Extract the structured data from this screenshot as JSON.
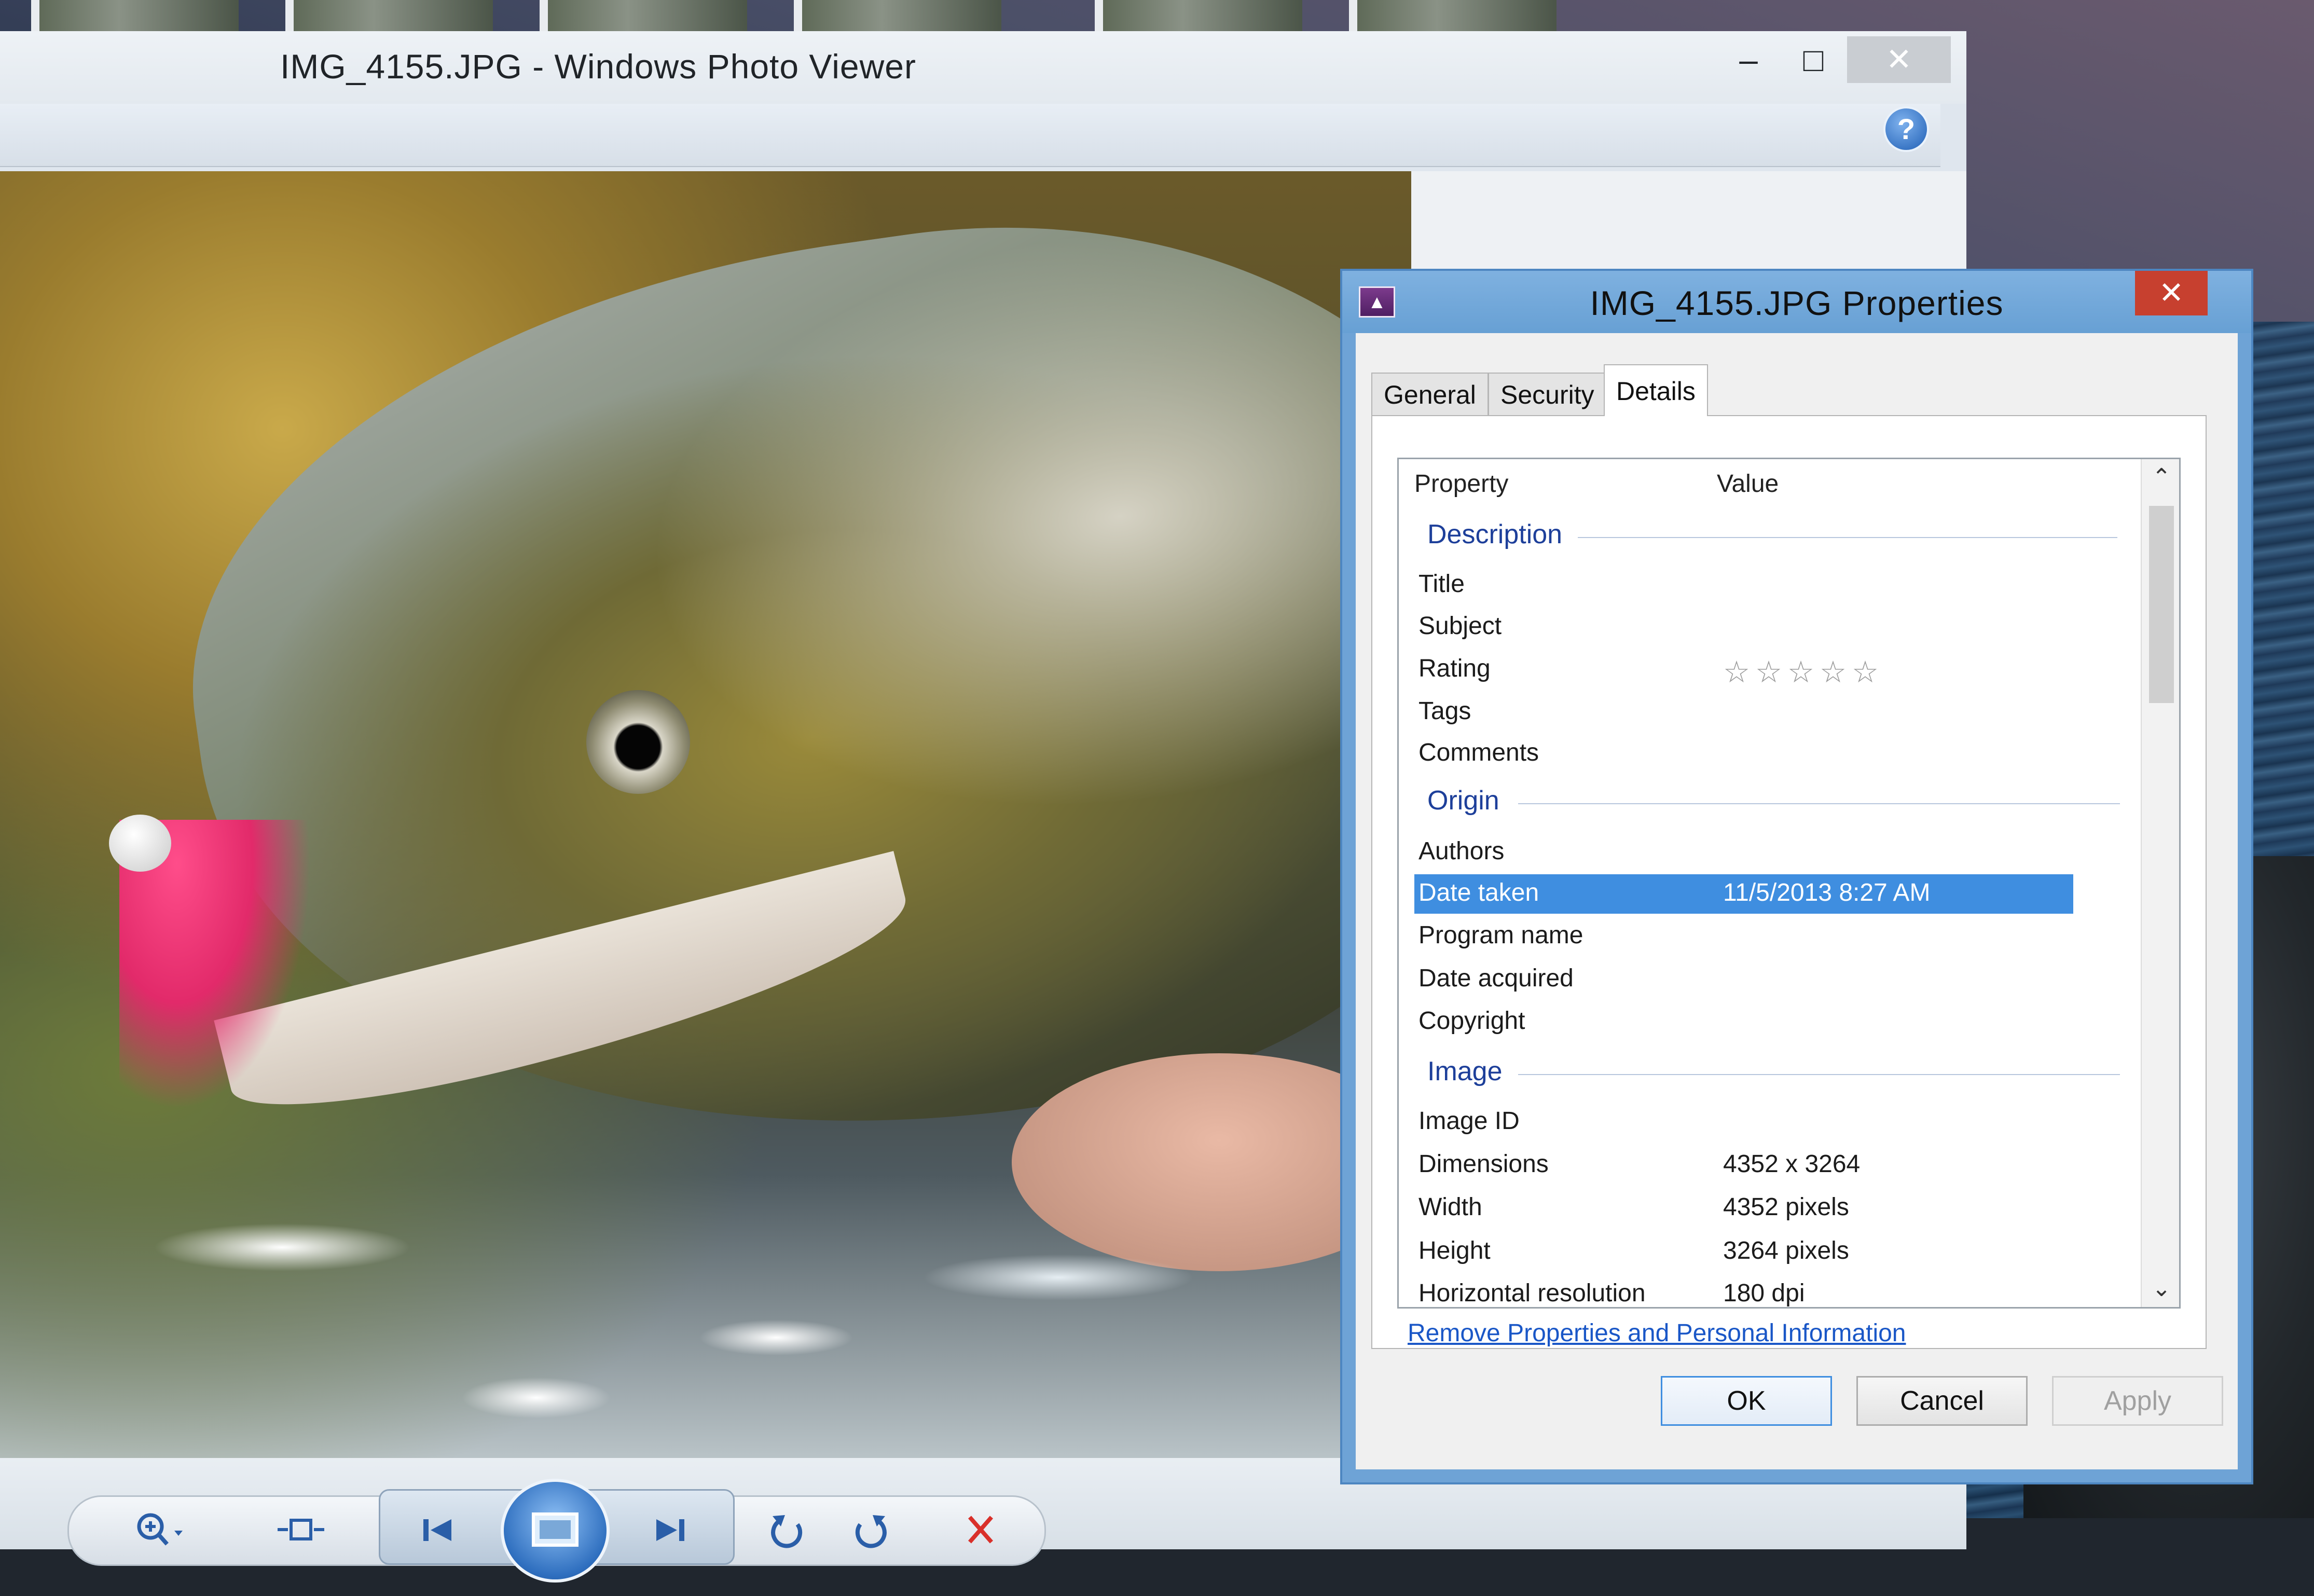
{
  "viewer": {
    "title": "IMG_4155.JPG - Windows Photo Viewer",
    "minimize_glyph": "–",
    "maximize_glyph": "□",
    "close_glyph": "✕",
    "help_glyph": "?",
    "help_icon": "help-icon"
  },
  "controls": {
    "zoom_icon": "zoom-icon",
    "fit_icon": "actual-size-icon",
    "prev_icon": "previous-icon",
    "slideshow_icon": "slideshow-icon",
    "next_icon": "next-icon",
    "rotate_ccw_icon": "rotate-counterclockwise-icon",
    "rotate_cw_icon": "rotate-clockwise-icon",
    "delete_icon": "delete-icon",
    "colors": {
      "accent": "#2a5ea8",
      "delete": "#d9302a"
    }
  },
  "dialog": {
    "title": "IMG_4155.JPG Properties",
    "close_glyph": "✕",
    "tabs": [
      {
        "label": "General",
        "active": false
      },
      {
        "label": "Security",
        "active": false
      },
      {
        "label": "Details",
        "active": true
      }
    ],
    "columns": {
      "property": "Property",
      "value": "Value"
    },
    "groups": {
      "description": "Description",
      "origin": "Origin",
      "image": "Image"
    },
    "rows": {
      "title": {
        "key": "Title",
        "value": ""
      },
      "subject": {
        "key": "Subject",
        "value": ""
      },
      "rating": {
        "key": "Rating",
        "value": "☆☆☆☆☆"
      },
      "tags": {
        "key": "Tags",
        "value": ""
      },
      "comments": {
        "key": "Comments",
        "value": ""
      },
      "authors": {
        "key": "Authors",
        "value": ""
      },
      "date_taken": {
        "key": "Date taken",
        "value": "11/5/2013 8:27 AM",
        "selected": true
      },
      "program_name": {
        "key": "Program name",
        "value": ""
      },
      "date_acquired": {
        "key": "Date acquired",
        "value": ""
      },
      "copyright": {
        "key": "Copyright",
        "value": ""
      },
      "image_id": {
        "key": "Image ID",
        "value": ""
      },
      "dimensions": {
        "key": "Dimensions",
        "value": "4352 x 3264"
      },
      "width": {
        "key": "Width",
        "value": "4352 pixels"
      },
      "height": {
        "key": "Height",
        "value": "3264 pixels"
      },
      "horizontal_resolution": {
        "key": "Horizontal resolution",
        "value": "180 dpi"
      }
    },
    "scroll_up_glyph": "⌃",
    "scroll_down_glyph": "⌄",
    "remove_link": "Remove Properties and Personal Information",
    "buttons": {
      "ok": "OK",
      "cancel": "Cancel",
      "apply": "Apply"
    },
    "colors": {
      "selection": "#3f8ee0",
      "group": "#1d3f9a",
      "link": "#1a57c7",
      "close": "#c7402f"
    }
  }
}
